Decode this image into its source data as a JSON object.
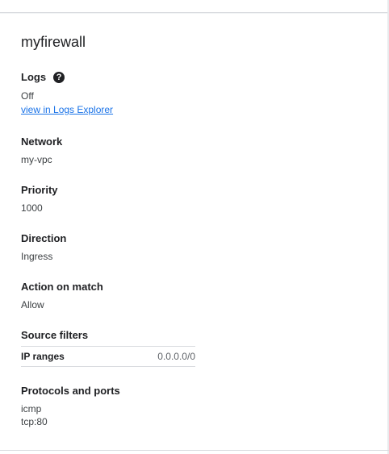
{
  "panel": {
    "title": "myfirewall",
    "logs": {
      "label": "Logs",
      "help_icon": "help-circle-icon",
      "status": "Off",
      "link_text": "view in Logs Explorer"
    },
    "network": {
      "label": "Network",
      "value": "my-vpc"
    },
    "priority": {
      "label": "Priority",
      "value": "1000"
    },
    "direction": {
      "label": "Direction",
      "value": "Ingress"
    },
    "action": {
      "label": "Action on match",
      "value": "Allow"
    },
    "source_filters": {
      "label": "Source filters",
      "ip_ranges_label": "IP ranges",
      "ip_ranges_value": "0.0.0.0/0"
    },
    "protocols": {
      "label": "Protocols and ports",
      "items": [
        "icmp",
        "tcp:80"
      ]
    }
  },
  "colors": {
    "link": "#1a73e8",
    "text": "#202124",
    "divider": "#dadce0"
  }
}
